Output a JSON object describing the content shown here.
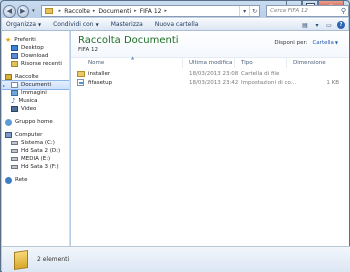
{
  "window": {
    "minimize_label": "minimize",
    "maximize_label": "maximize",
    "close_label": "x"
  },
  "address": {
    "crumbs": [
      "Raccolte",
      "Documenti",
      "FIFA 12"
    ],
    "refresh": "↻"
  },
  "search": {
    "placeholder": "Cerca FIFA 12"
  },
  "toolbar": {
    "organize_label": "Organizza",
    "share_label": "Condividi con",
    "burn_label": "Masterizza",
    "new_folder_label": "Nuova cartella"
  },
  "sidebar": {
    "favorites": {
      "label": "Preferiti",
      "items": [
        "Desktop",
        "Download",
        "Risorse recenti"
      ]
    },
    "libraries": {
      "label": "Raccolte",
      "items": [
        "Documenti",
        "Immagini",
        "Musica",
        "Video"
      ]
    },
    "homegroup": {
      "label": "Gruppo home"
    },
    "computer": {
      "label": "Computer",
      "items": [
        "Sistema (C:)",
        "Hd Sata 2 (D:)",
        "MEDIA (E:)",
        "Hd Sata 3 (F:)"
      ]
    },
    "network": {
      "label": "Rete"
    }
  },
  "library": {
    "title": "Raccolta Documenti",
    "subtitle": "FIFA 12",
    "arrange_by_label": "Disponi per:",
    "arrange_by_value": "Cartella"
  },
  "columns": {
    "name": "Nome",
    "date": "Ultima modifica",
    "type": "Tipo",
    "size": "Dimensione"
  },
  "files": [
    {
      "name": "installer",
      "date": "18/03/2013 23:08",
      "type": "Cartella di file",
      "size": ""
    },
    {
      "name": "fifasetup",
      "date": "18/03/2013 23:42",
      "type": "Impostazioni di co...",
      "size": "1 KB"
    }
  ],
  "details": {
    "count_text": "2 elementi"
  }
}
